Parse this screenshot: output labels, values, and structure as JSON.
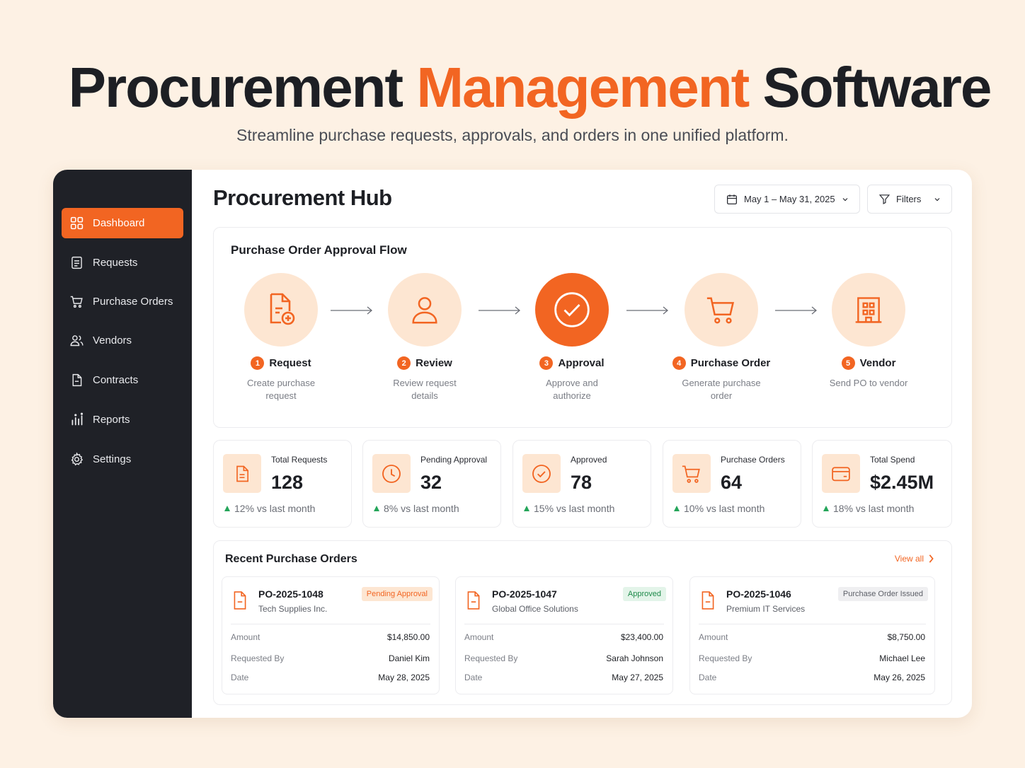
{
  "hero": {
    "title_part1": "Procurement",
    "title_accent": "Management",
    "title_part2": "Software",
    "subtitle": "Streamline purchase requests, approvals, and orders in one unified platform."
  },
  "colors": {
    "accent": "#f26522",
    "accent_soft": "#fde6d2",
    "sidebar_bg": "#1f2127",
    "positive": "#23a559"
  },
  "sidebar": {
    "items": [
      {
        "label": "Dashboard",
        "icon": "grid-icon",
        "active": true
      },
      {
        "label": "Requests",
        "icon": "document-list-icon",
        "active": false
      },
      {
        "label": "Purchase Orders",
        "icon": "cart-icon",
        "active": false
      },
      {
        "label": "Vendors",
        "icon": "users-icon",
        "active": false
      },
      {
        "label": "Contracts",
        "icon": "file-icon",
        "active": false
      },
      {
        "label": "Reports",
        "icon": "bar-chart-icon",
        "active": false
      },
      {
        "label": "Settings",
        "icon": "gear-icon",
        "active": false
      }
    ]
  },
  "header": {
    "title": "Procurement Hub",
    "date_range": "May 1 – May 31, 2025",
    "filters_label": "Filters"
  },
  "flow": {
    "title": "Purchase Order Approval Flow",
    "steps": [
      {
        "num": "1",
        "title": "Request",
        "desc": "Create purchase request",
        "icon": "file-plus-icon",
        "active": false
      },
      {
        "num": "2",
        "title": "Review",
        "desc": "Review request details",
        "icon": "user-icon",
        "active": false
      },
      {
        "num": "3",
        "title": "Approval",
        "desc": "Approve and authorize",
        "icon": "check-circle-icon",
        "active": true
      },
      {
        "num": "4",
        "title": "Purchase Order",
        "desc": "Generate purchase order",
        "icon": "cart-icon",
        "active": false
      },
      {
        "num": "5",
        "title": "Vendor",
        "desc": "Send PO to vendor",
        "icon": "building-icon",
        "active": false
      }
    ]
  },
  "stats": [
    {
      "label": "Total Requests",
      "value": "128",
      "trend": "12% vs last month",
      "icon": "file-icon"
    },
    {
      "label": "Pending Approval",
      "value": "32",
      "trend": "8% vs last month",
      "icon": "clock-icon"
    },
    {
      "label": "Approved",
      "value": "78",
      "trend": "15% vs last month",
      "icon": "check-circle-icon"
    },
    {
      "label": "Purchase Orders",
      "value": "64",
      "trend": "10% vs last month",
      "icon": "cart-icon"
    },
    {
      "label": "Total Spend",
      "value": "$2.45M",
      "trend": "18% vs last month",
      "icon": "wallet-icon"
    }
  ],
  "orders": {
    "title": "Recent Purchase Orders",
    "view_all": "View all",
    "field_labels": {
      "amount": "Amount",
      "requested_by": "Requested By",
      "date": "Date"
    },
    "items": [
      {
        "id": "PO-2025-1048",
        "vendor": "Tech Supplies Inc.",
        "status": "Pending Approval",
        "status_color": "#f26522",
        "status_bg": "#fde6d2",
        "amount": "$14,850.00",
        "requested_by": "Daniel Kim",
        "date": "May 28, 2025"
      },
      {
        "id": "PO-2025-1047",
        "vendor": "Global Office Solutions",
        "status": "Approved",
        "status_color": "#1e8a4a",
        "status_bg": "#e3f4e9",
        "amount": "$23,400.00",
        "requested_by": "Sarah Johnson",
        "date": "May 27, 2025"
      },
      {
        "id": "PO-2025-1046",
        "vendor": "Premium IT Services",
        "status": "Purchase Order Issued",
        "status_color": "#5c5f67",
        "status_bg": "#efeff1",
        "amount": "$8,750.00",
        "requested_by": "Michael Lee",
        "date": "May 26, 2025"
      }
    ]
  }
}
